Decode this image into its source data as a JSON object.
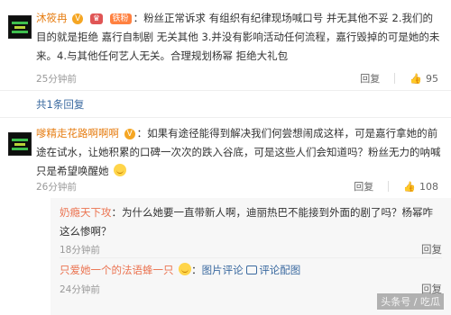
{
  "comments": [
    {
      "username": "沐筱冉",
      "badge_fan": "铁粉",
      "text": "粉丝正常诉求 有组织有纪律现场喊口号 并无其他不妥 2.我们的目的就是拒绝 嘉行自制剧 无关其他 3.并没有影响活动任何流程，嘉行毁掉的可是她的未来。4.与其他任何艺人无关。合理规划杨幂 拒绝大礼包",
      "time": "25分钟前",
      "reply_label": "回复",
      "likes": "95"
    },
    {
      "username": "嗲精走花路啊啊啊",
      "text": "如果有途径能得到解决我们何尝想闹成这样，可是嘉行拿她的前途在试水，让她积累的口碑一次次的跌入谷底，可是这些人们会知道吗？粉丝无力的呐喊只是希望唤醒她",
      "time": "26分钟前",
      "reply_label": "回复",
      "likes": "108"
    }
  ],
  "more_replies": "共1条回复",
  "replies": [
    {
      "username": "奶瘾天下攻",
      "text": "为什么她要一直带新人啊，迪丽热巴不能接到外面的剧了吗？杨幂咋这么惨啊？",
      "time": "18分钟前",
      "reply_label": "回复"
    },
    {
      "username": "只爱她一个的法语蜂一只",
      "pic_comment": "图片评论",
      "pic_comment_link": "评论配图",
      "time": "24分钟前",
      "reply_label": "回复"
    }
  ],
  "watermark": "头条号 / 吃瓜"
}
